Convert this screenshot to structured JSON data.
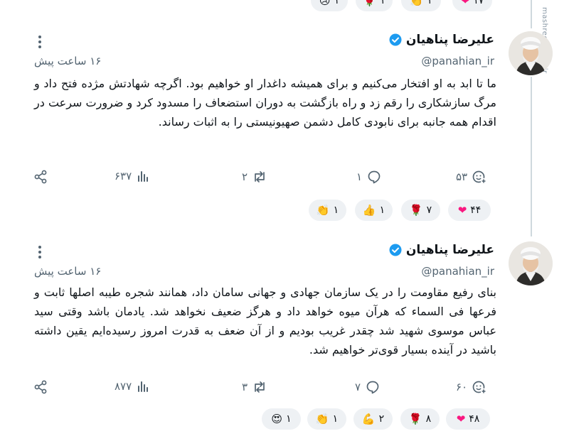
{
  "watermark": "mashreghnews.ir",
  "top_reactions": [
    {
      "icon": "heart-icon",
      "emoji": "❤",
      "count": "۱۷"
    },
    {
      "icon": "clap-icon",
      "emoji": "👏",
      "count": "۱"
    },
    {
      "icon": "rose-icon",
      "emoji": "🌹",
      "count": "۱"
    },
    {
      "icon": "sad-icon",
      "emoji": "😢",
      "count": "۱"
    }
  ],
  "posts": [
    {
      "display_name": "علیرضا پناهیان",
      "handle": "@panahian_ir",
      "time": "۱۶ ساعت پیش",
      "text": "ما تا ابد به او افتخار می‌کنیم و برای همیشه داغدار او خواهیم بود. اگرچه شهادتش مژده فتح داد و مرگ سازشکاری را رقم زد و راه بازگشت به دوران استضعاف را مسدود کرد و ضرورت سرعت در اقدام همه جانبه برای نابودی کامل دشمن صهیونیستی را به اثبات رساند.",
      "stats": {
        "reactions": "۵۳",
        "replies": "۱",
        "reposts": "۲",
        "views": "۶۳۷"
      },
      "reactions": [
        {
          "icon": "heart-icon",
          "emoji": "❤",
          "count": "۴۴"
        },
        {
          "icon": "rose-icon",
          "emoji": "🌹",
          "count": "۷"
        },
        {
          "icon": "thumbs-up-icon",
          "emoji": "👍",
          "count": "۱"
        },
        {
          "icon": "clap-icon",
          "emoji": "👏",
          "count": "۱"
        }
      ]
    },
    {
      "display_name": "علیرضا پناهیان",
      "handle": "@panahian_ir",
      "time": "۱۶ ساعت پیش",
      "text": "بنای رفیع مقاومت را در یک سازمان جهادی و جهانی سامان داد، همانند شجره طیبه اصلها ثابت و فرعها فی السماء که هرآن میوه خواهد داد و هرگز ضعیف نخواهد شد. یادمان باشد وقتی سید عباس موسوی شهید شد چقدر غریب بودیم و از آن ضعف به قدرت امروز رسیده‌ایم یقین داشته باشید در آینده بسیار قوی‌تر خواهیم شد.",
      "stats": {
        "reactions": "۶۰",
        "replies": "۷",
        "reposts": "۳",
        "views": "۸۷۷"
      },
      "reactions": [
        {
          "icon": "heart-icon",
          "emoji": "❤",
          "count": "۴۸"
        },
        {
          "icon": "rose-icon",
          "emoji": "🌹",
          "count": "۸"
        },
        {
          "icon": "flexed-biceps-icon",
          "emoji": "💪",
          "count": "۲"
        },
        {
          "icon": "clap-icon",
          "emoji": "👏",
          "count": "۱"
        },
        {
          "icon": "heart-eyes-icon",
          "emoji": "😍",
          "count": "۱"
        }
      ]
    }
  ],
  "colors": {
    "accent": "#1d9bf0",
    "muted": "#536471",
    "chip_bg": "#eef1f4",
    "heart": "#f91880"
  }
}
